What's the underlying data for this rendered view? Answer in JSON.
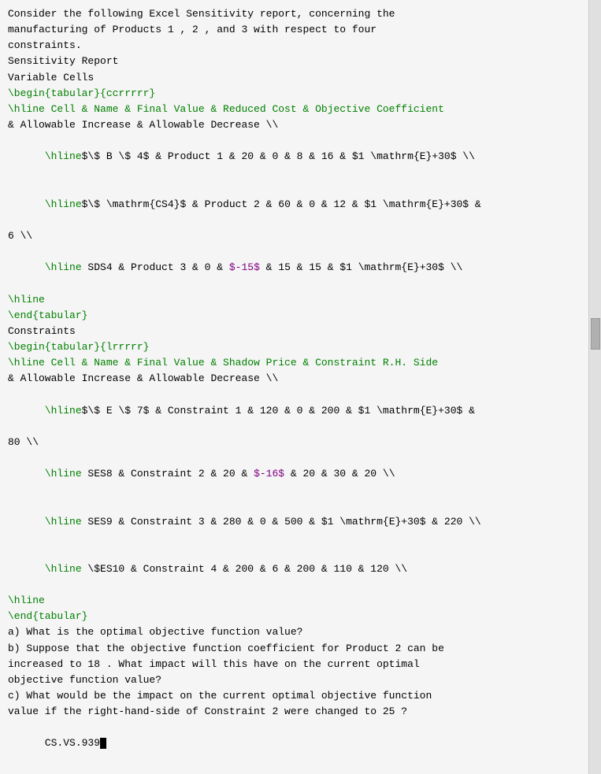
{
  "content": {
    "intro_line1": "Consider the following Excel Sensitivity report, concerning the",
    "intro_line2": "manufacturing of Products 1 , 2 , and 3 with respect to four",
    "intro_line3": "constraints.",
    "sensitivity_report": "Sensitivity Report",
    "variable_cells": "Variable Cells",
    "tabular_begin_vc": "\\begin{tabular}{ccrrrrr}",
    "hline_vc_header": "\\hline Cell & Name & Final Value & Reduced Cost & Objective Coefficient",
    "allowable_line": "& Allowable Increase & Allowable Decrease \\\\",
    "vc_row1": "\\hline$\\$ B \\$ 4$ & Product 1 & 20 & 0 & 8 & 16 & $1 \\mathrm{E}+30$ \\\\",
    "vc_row2": "\\hline$\\$ \\mathrm{CS4}$ & Product 2 & 60 & 0 & 12 & $1 \\mathrm{E}+30$ &",
    "vc_row2b": "6 \\\\",
    "vc_row3": "\\hline SDS4 & Product 3 & 0 & $-15$ & 15 & 15 & $1 \\mathrm{E}+30$ \\\\",
    "hline1": "\\hline",
    "tabular_end_vc": "\\end{tabular}",
    "constraints": "Constraints",
    "tabular_begin_c": "\\begin{tabular}{lrrrrr}",
    "hline_c_header": "\\hline Cell & Name & Final Value & Shadow Price & Constraint R.H. Side",
    "allowable_line_c": "& Allowable Increase & Allowable Decrease \\\\",
    "c_row1": "\\hline$\\$ E \\$ 7$ & Constraint 1 & 120 & 0 & 200 & $1 \\mathrm{E}+30$ &",
    "c_row1b": "80 \\\\",
    "c_row2": "\\hline SES8 & Constraint 2 & 20 & $-16$ & 20 & 30 & 20 \\\\",
    "c_row3": "\\hline SES9 & Constraint 3 & 280 & 0 & 500 & $1 \\mathrm{E}+30$ & 220 \\\\",
    "c_row4": "\\hline \\$ES10 & Constraint 4 & 200 & 6 & 200 & 110 & 120 \\\\",
    "hline2": "\\hline",
    "tabular_end_c": "\\end{tabular}",
    "qa": "a) What is the optimal objective function value?",
    "qb_line1": "b) Suppose that the objective function coefficient for Product 2 can be",
    "qb_line2": "increased to 18 . What impact will this have on the current optimal",
    "qb_line3": "objective function value?",
    "qc_line1": "c) What would be the impact on the current optimal objective function",
    "qc_line2": "value if the right-hand-side of Constraint 2 were changed to 25 ?",
    "cursor_line": "CS.VS.939"
  }
}
